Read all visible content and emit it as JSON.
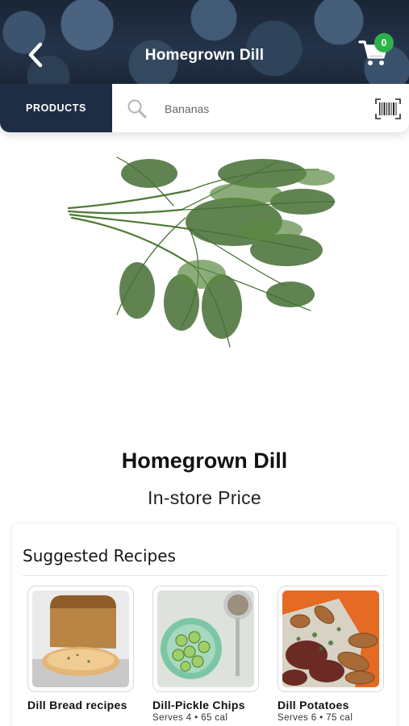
{
  "header": {
    "title": "Homegrown Dill",
    "cart_count": "0",
    "back_icon": "chevron-left-icon",
    "cart_icon": "cart-icon"
  },
  "search": {
    "tab_label": "PRODUCTS",
    "placeholder": "Bananas",
    "search_icon": "search-icon",
    "barcode_icon": "barcode-icon"
  },
  "product": {
    "name": "Homegrown Dill",
    "price_label": "In-store Price"
  },
  "recipes": {
    "title": "Suggested Recipes",
    "items": [
      {
        "name": "Dill Bread recipes",
        "meta": ""
      },
      {
        "name": "Dill-Pickle Chips",
        "meta": "Serves 4 • 65 cal"
      },
      {
        "name": "Dill Potatoes",
        "meta": "Serves 6 • 75 cal"
      }
    ]
  },
  "colors": {
    "nav_dark": "#1f2d44",
    "badge_green": "#2db24a"
  }
}
